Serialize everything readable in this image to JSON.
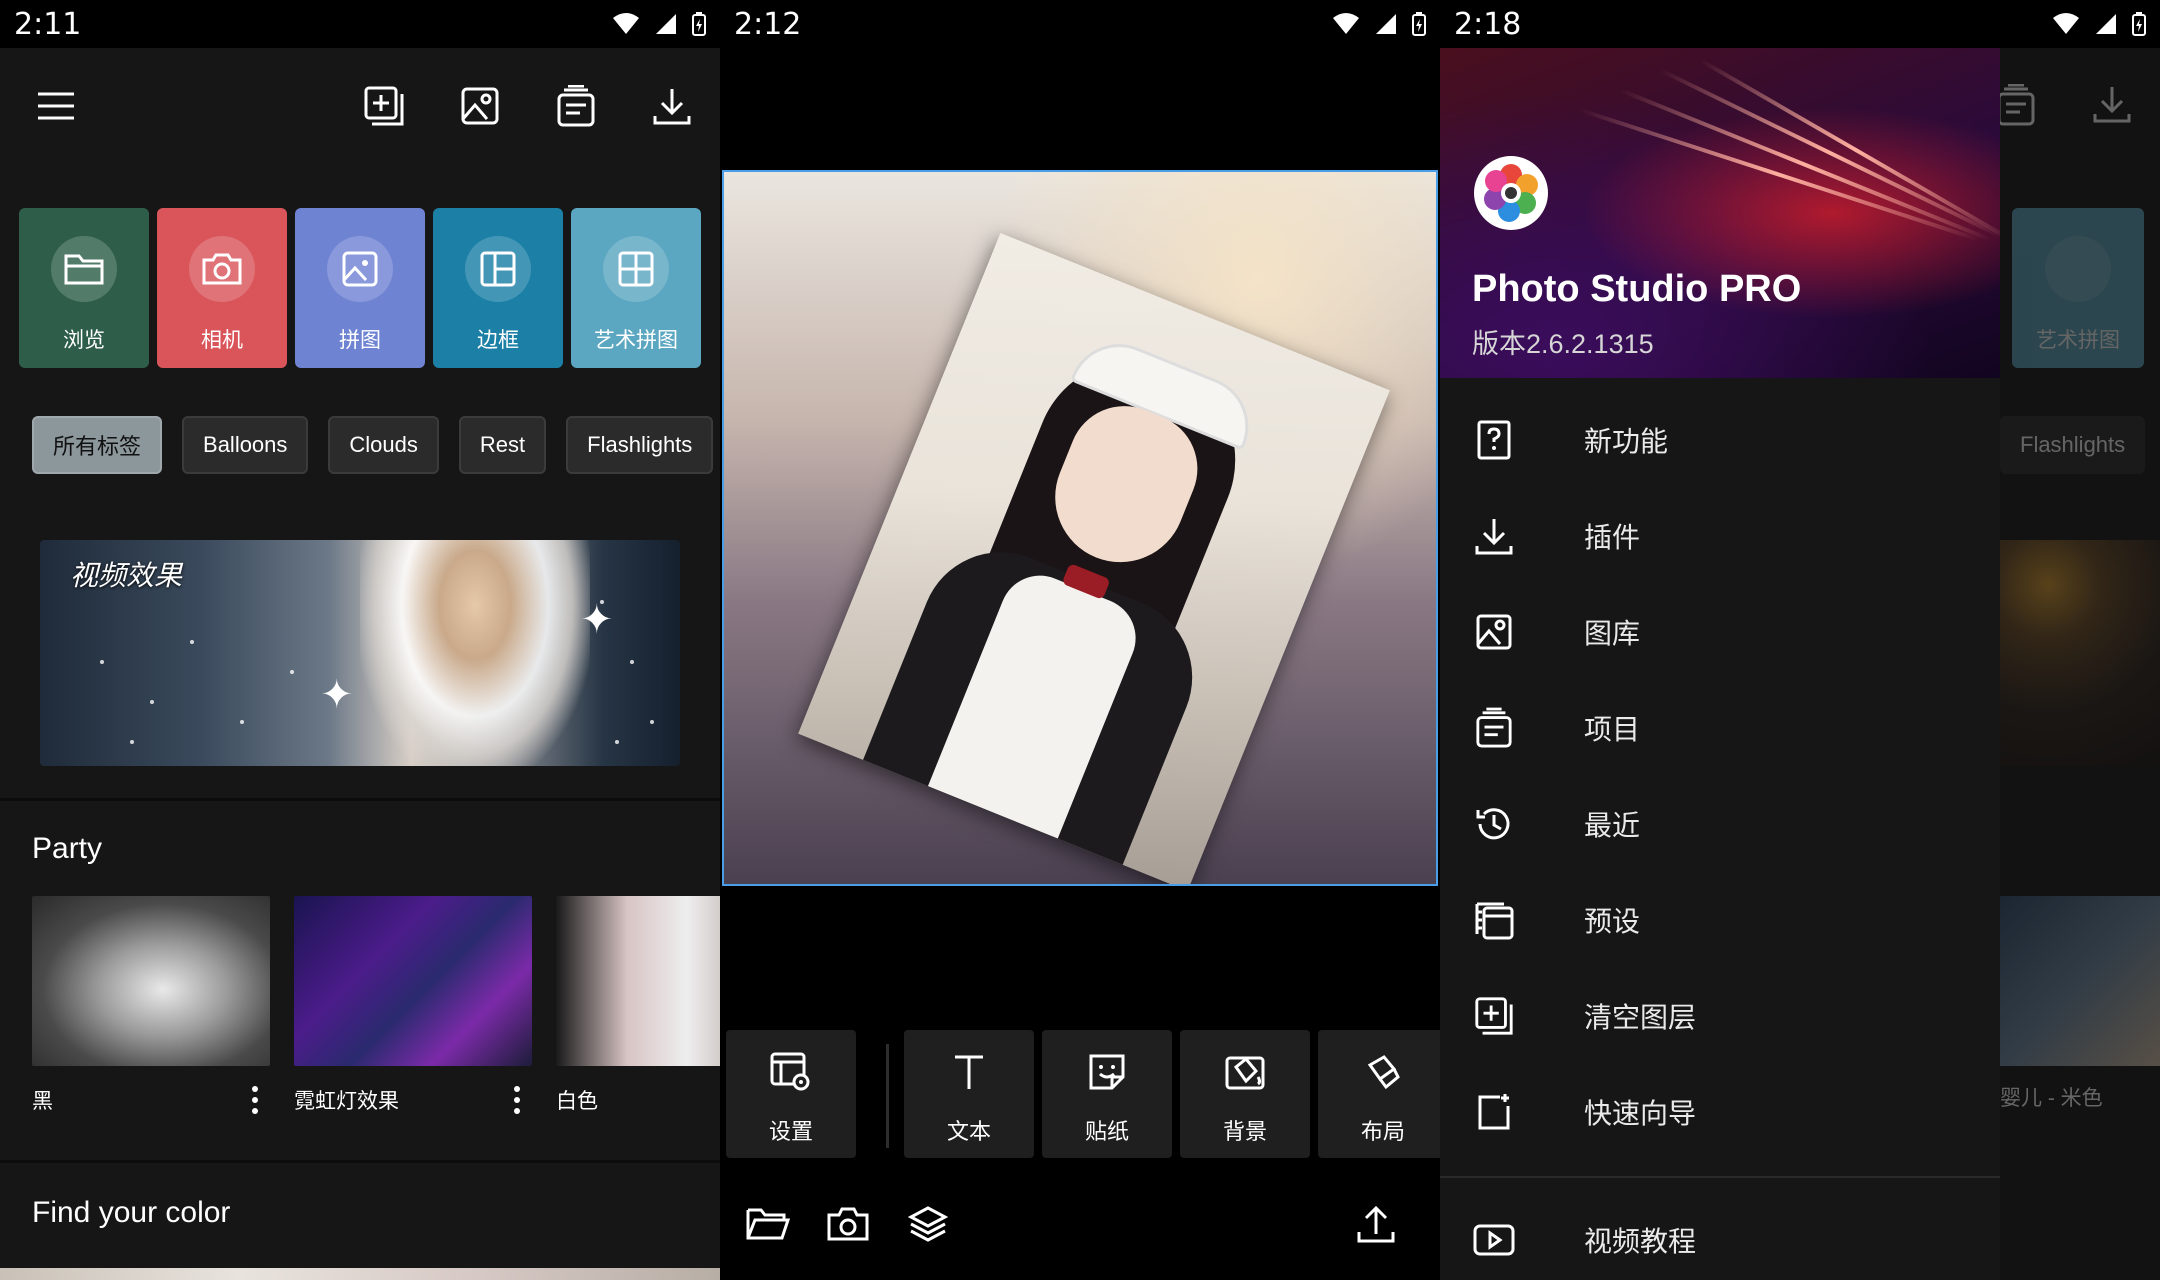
{
  "panel1": {
    "status_time": "2:11",
    "toolbar": {
      "menu_icon": "hamburger-menu-icon",
      "actions": [
        "add-layer-icon",
        "gallery-icon",
        "projects-icon",
        "download-icon"
      ]
    },
    "tiles": [
      {
        "label": "浏览",
        "icon": "folder-icon",
        "color": "#2e5e4a"
      },
      {
        "label": "相机",
        "icon": "camera-icon",
        "color": "#d9555a"
      },
      {
        "label": "拼图",
        "icon": "collage-icon",
        "color": "#6f83d3"
      },
      {
        "label": "边框",
        "icon": "frame-icon",
        "color": "#1b7fa6"
      },
      {
        "label": "艺术拼图",
        "icon": "art-collage-icon",
        "color": "#5ba6c1"
      }
    ],
    "chips": [
      "所有标签",
      "Balloons",
      "Clouds",
      "Rest",
      "Flashlights"
    ],
    "banner_title": "视频效果",
    "section_party": "Party",
    "cards": [
      {
        "label": "黑"
      },
      {
        "label": "霓虹灯效果"
      },
      {
        "label": "白色"
      }
    ],
    "section_color": "Find your color"
  },
  "panel2": {
    "status_time": "2:12",
    "tools": [
      {
        "label": "设置",
        "icon": "settings-layout-icon"
      },
      {
        "label": "文本",
        "icon": "text-icon"
      },
      {
        "label": "贴纸",
        "icon": "sticker-icon"
      },
      {
        "label": "背景",
        "icon": "background-fill-icon"
      },
      {
        "label": "布局",
        "icon": "layout-icon"
      }
    ],
    "bottom_nav": [
      "open-folder-icon",
      "camera-icon",
      "layers-icon",
      "share-upload-icon"
    ],
    "accent": "#4a9ee8"
  },
  "panel3": {
    "status_time": "2:18",
    "app_name": "Photo Studio PRO",
    "version": "版本2.6.2.1315",
    "menu": [
      {
        "label": "新功能",
        "icon": "whats-new-icon"
      },
      {
        "label": "插件",
        "icon": "plugin-download-icon"
      },
      {
        "label": "图库",
        "icon": "gallery-icon"
      },
      {
        "label": "项目",
        "icon": "projects-icon"
      },
      {
        "label": "最近",
        "icon": "history-icon"
      },
      {
        "label": "预设",
        "icon": "presets-icon"
      },
      {
        "label": "清空图层",
        "icon": "clear-layers-icon"
      },
      {
        "label": "快速向导",
        "icon": "quick-guide-icon"
      },
      {
        "label": "视频教程",
        "icon": "video-tutorial-icon"
      }
    ],
    "behind": {
      "tile_label": "艺术拼图",
      "chip_label": "Flashlights",
      "card_label": "婴儿 - 米色"
    }
  }
}
